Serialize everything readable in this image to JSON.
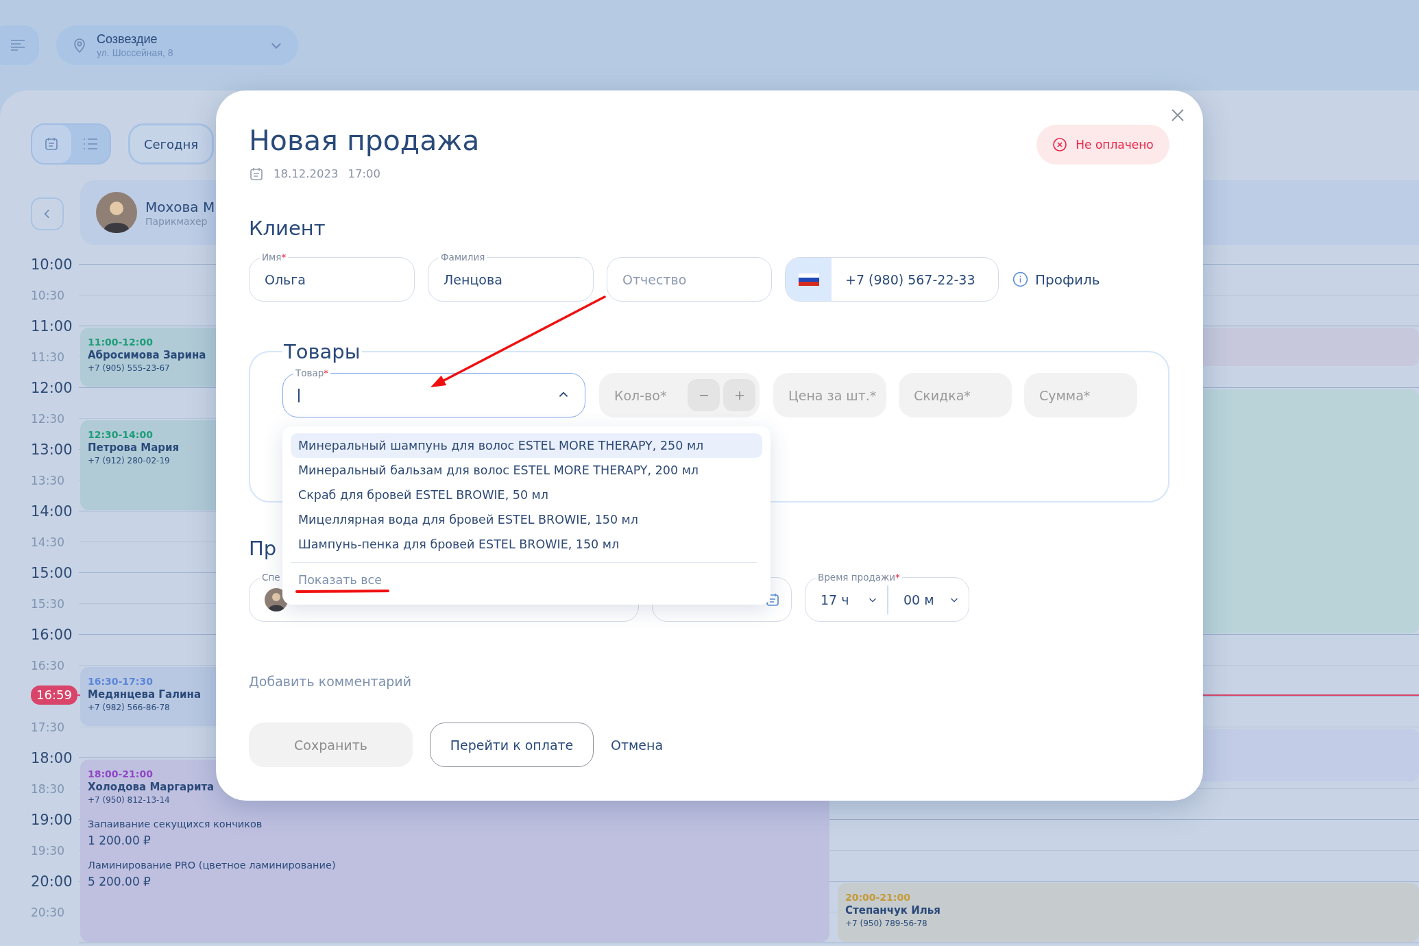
{
  "location": {
    "name": "Созвездие",
    "address": "ул. Шоссейная, 8"
  },
  "view_switch": [
    {
      "kind": "calendar",
      "selected": true
    },
    {
      "kind": "list",
      "selected": false
    }
  ],
  "today_button": "Сегодня",
  "staff": {
    "name": "Мохова М",
    "role": "Парикмахер"
  },
  "times": [
    {
      "kind": "hour",
      "label": "10:00"
    },
    {
      "kind": "half",
      "label": "10:30"
    },
    {
      "kind": "hour",
      "label": "11:00"
    },
    {
      "kind": "half",
      "label": "11:30"
    },
    {
      "kind": "hour",
      "label": "12:00"
    },
    {
      "kind": "half",
      "label": "12:30"
    },
    {
      "kind": "hour",
      "label": "13:00"
    },
    {
      "kind": "half",
      "label": "13:30"
    },
    {
      "kind": "hour",
      "label": "14:00"
    },
    {
      "kind": "half",
      "label": "14:30"
    },
    {
      "kind": "hour",
      "label": "15:00"
    },
    {
      "kind": "half",
      "label": "15:30"
    },
    {
      "kind": "hour",
      "label": "16:00"
    },
    {
      "kind": "half",
      "label": "16:30"
    },
    {
      "kind": "hour"
    },
    {
      "kind": "half",
      "label": "17:30"
    },
    {
      "kind": "hour",
      "label": "18:00"
    },
    {
      "kind": "half",
      "label": "18:30"
    },
    {
      "kind": "hour",
      "label": "19:00"
    },
    {
      "kind": "half",
      "label": "19:30"
    },
    {
      "kind": "hour",
      "label": "20:00"
    },
    {
      "kind": "half",
      "label": "20:30"
    },
    {
      "kind": "hour"
    }
  ],
  "now": "16:59",
  "columns": [
    {
      "appointments": [
        {
          "time": "11:00-12:00",
          "name": "Абросимова Зарина",
          "phone": "+7 (905) 555-23-67",
          "color": "#1e9c78"
        },
        {
          "time": "12:30-14:00",
          "name": "Петрова Мария",
          "phone": "+7 (912) 280-02-19",
          "color": "#1e9c78"
        },
        {
          "time": "16:30-17:30",
          "name": "Медянцева Галина",
          "phone": "+7 (982) 566-86-78",
          "color": "#5b86d8"
        },
        {
          "time": "18:00-21:00",
          "name": "Холодова Маргарита",
          "phone": "+7 (950) 812-13-14",
          "color": "#9046c4",
          "services": [
            {
              "name": "Запаивание секущихся кончиков",
              "price": "1 200.00 ₽"
            },
            {
              "name": "Ламинирование PRO (цветное ламинирование)",
              "price": "5 200.00 ₽"
            }
          ]
        }
      ]
    },
    {
      "appointments": [
        {
          "time": "20:00-21:00",
          "name": "Степанчук Илья",
          "phone": "+7 (950) 789-56-78",
          "color": "#c49a36"
        }
      ]
    }
  ],
  "sale": {
    "title": "Новая продажа",
    "date": "18.12.2023",
    "time": "17:00",
    "status": {
      "label": "Не оплачено",
      "paid": false
    },
    "client": {
      "heading": "Клиент",
      "fields": [
        {
          "label": "Имя",
          "required_mark": "*",
          "value": "Ольга"
        },
        {
          "label": "Фамилия",
          "value": "Ленцова"
        },
        {
          "placeholder": "Отчество"
        }
      ],
      "phone": "+7 (980) 567-22-33",
      "profile_link": "Профиль"
    },
    "products": {
      "heading": "Товары",
      "product_field": {
        "label": "Товар",
        "required_mark": "*",
        "expanded": true
      },
      "quantity": {
        "placeholder": "Кол-во*"
      },
      "price": {
        "placeholder": "Цена за шт.*"
      },
      "discount": {
        "placeholder": "Скидка*"
      },
      "sum": {
        "placeholder": "Сумма*"
      },
      "options": [
        {
          "label": "Минеральный шампунь для волос ESTEL MORE THERAPY, 250 мл",
          "highlighted": true
        },
        {
          "label": "Минеральный бальзам для волос ESTEL MORE THERAPY, 200 мл",
          "highlighted": false
        },
        {
          "label": "Скраб для бровей ESTEL BROWIE, 50 мл",
          "highlighted": false
        },
        {
          "label": "Мицеллярная вода для бровей ESTEL BROWIE, 150 мл",
          "highlighted": false
        },
        {
          "label": "Шампунь-пенка для бровей ESTEL BROWIE, 150 мл",
          "highlighted": false
        }
      ],
      "show_all": "Показать все"
    },
    "details": {
      "heading": "Пр",
      "specialist_label": "Спе",
      "sale_time": {
        "label": "Время продажи",
        "required_mark": "*",
        "hours": "17 ч",
        "minutes": "00 м"
      }
    },
    "comment_link": "Добавить комментарий",
    "buttons": [
      {
        "kind": "filled",
        "label": "Сохранить",
        "disabled": true
      },
      {
        "kind": "outline",
        "label": "Перейти к оплате",
        "disabled": false
      },
      {
        "kind": "link",
        "label": "Отмена",
        "disabled": false
      }
    ]
  }
}
